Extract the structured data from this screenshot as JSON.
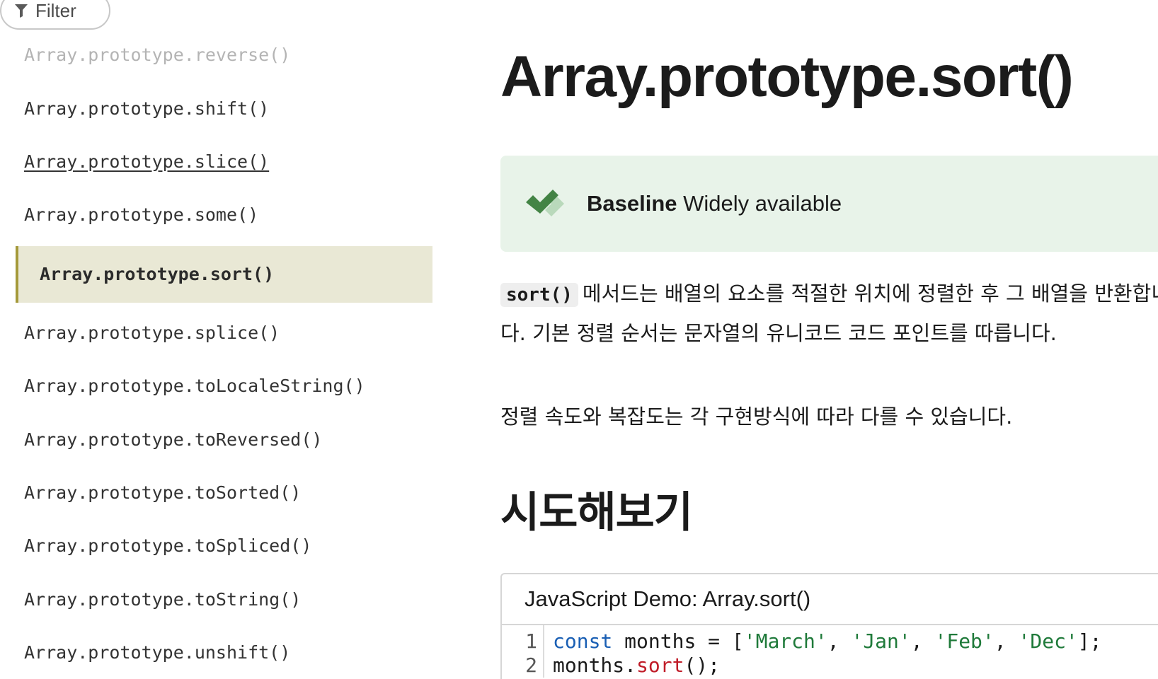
{
  "sidebar": {
    "filter_label": "Filter",
    "items": [
      {
        "label": "Array.prototype.reverse()"
      },
      {
        "label": "Array.prototype.shift()"
      },
      {
        "label": "Array.prototype.slice()"
      },
      {
        "label": "Array.prototype.some()"
      },
      {
        "label": "Array.prototype.sort()"
      },
      {
        "label": "Array.prototype.splice()"
      },
      {
        "label": "Array.prototype.toLocaleString()"
      },
      {
        "label": "Array.prototype.toReversed()"
      },
      {
        "label": "Array.prototype.toSorted()"
      },
      {
        "label": "Array.prototype.toSpliced()"
      },
      {
        "label": "Array.prototype.toString()"
      },
      {
        "label": "Array.prototype.unshift()"
      }
    ],
    "active_index": 4
  },
  "main": {
    "title": "Array.prototype.sort()",
    "baseline": {
      "strong": "Baseline",
      "status": "Widely available"
    },
    "description": {
      "code": "sort()",
      "line1": "메서드는 배열의 요소를 적절한 위치에 정렬한 후 그 배열을 반환합니",
      "line2": "다. 기본 정렬 순서는 문자열의 유니코드 코드 포인트를 따릅니다."
    },
    "note": "정렬 속도와 복잡도는 각 구현방식에 따라 다를 수 있습니다.",
    "section_heading": "시도해보기",
    "demo": {
      "title": "JavaScript Demo: Array.sort()",
      "line_numbers": [
        "1",
        "2"
      ],
      "line1": {
        "kw": "const",
        "mid": " months = [",
        "s1": "'March'",
        "s2": "'Jan'",
        "s3": "'Feb'",
        "s4": "'Dec'",
        "sep": ", ",
        "end": "];"
      },
      "line2": {
        "obj": "months.",
        "fn": "sort",
        "end": "();"
      }
    }
  },
  "colors": {
    "active_bg": "#e9e8d5",
    "active_border": "#a4993a",
    "baseline_bg": "#e8f3e9",
    "baseline_check": "#3a7d3c",
    "code_keyword": "#1a5fb4",
    "code_string": "#1f7a3a",
    "code_function": "#c01c28"
  }
}
